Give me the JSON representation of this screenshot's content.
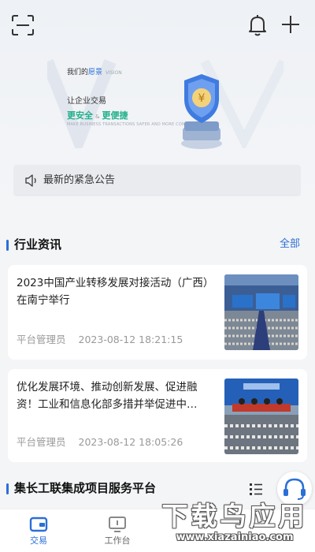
{
  "topbar": {
    "scan_icon": "scan-icon",
    "bell_icon": "bell-icon",
    "add_icon": "plus-icon"
  },
  "banner": {
    "vision_label_prefix": "我们的",
    "vision_label_highlight": "愿景",
    "vision_label_en": "VISION",
    "slogan_line1": "让企业交易",
    "slogan_safe": "更安全",
    "slogan_amp": "&",
    "slogan_easy": "更便捷",
    "slogan_small": "MAKE BUSINESS TRANSACTIONS SAFER AND MORE CONVENIENT",
    "accent_color": "#20b08a",
    "active_slide": 2,
    "slide_count": 3
  },
  "notice": {
    "icon": "speaker-icon",
    "text": "最新的紧急公告"
  },
  "industry_news": {
    "title": "行业资讯",
    "more_label": "全部",
    "items": [
      {
        "title": "2023中国产业转移发展对接活动（广西）在南宁举行",
        "author": "平台管理员",
        "time": "2023-08-12 18:21:15",
        "image": "conference-hall-photo"
      },
      {
        "title": "优化发展环境、推动创新发展、促进融资！工业和信息化部多措并举促进中…",
        "author": "平台管理员",
        "time": "2023-08-12 18:05:26",
        "image": "press-conference-photo"
      }
    ]
  },
  "platform_section": {
    "title": "集长工联集成项目服务平台",
    "list_icon": "list-icon",
    "service_icon": "headset-icon"
  },
  "tabbar": {
    "items": [
      {
        "label": "交易",
        "icon": "wallet-icon",
        "active": true
      },
      {
        "label": "工作台",
        "icon": "monitor-icon",
        "active": false
      }
    ],
    "active_color": "#2b6fd6"
  },
  "watermark": {
    "text": "下载鸟应用",
    "url": "www.xiazainiao.com"
  }
}
